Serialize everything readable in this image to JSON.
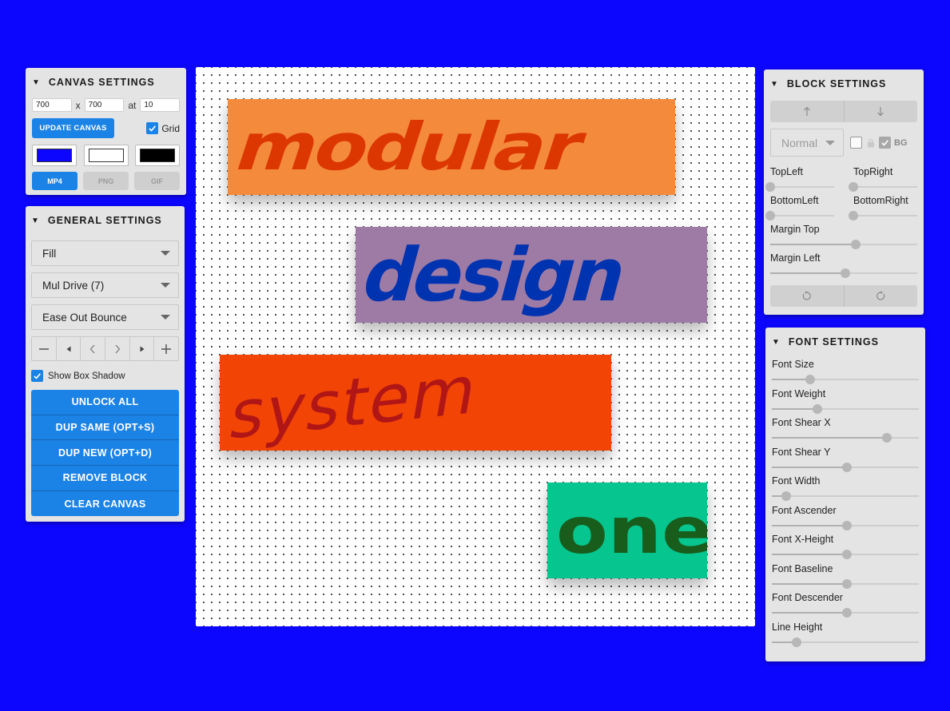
{
  "canvas_settings": {
    "title": "CANVAS SETTINGS",
    "width": "700",
    "x_label": "x",
    "height": "700",
    "at_label": "at",
    "grid_size": "10",
    "update_button": "UPDATE CANVAS",
    "grid_label": "Grid",
    "grid_checked": true,
    "swatches": [
      "#0d06ff",
      "#ffffff",
      "#000000"
    ],
    "export_buttons": [
      "MP4",
      "PNG",
      "GIF"
    ]
  },
  "general_settings": {
    "title": "GENERAL SETTINGS",
    "fill_mode": "Fill",
    "drive_mode": "Mul Drive (7)",
    "easing": "Ease Out Bounce",
    "show_box_shadow_label": "Show Box Shadow",
    "show_box_shadow_checked": true,
    "actions": [
      "UNLOCK ALL",
      "DUP SAME (OPT+S)",
      "DUP NEW (OPT+D)",
      "REMOVE BLOCK",
      "CLEAR CANVAS"
    ]
  },
  "canvas": {
    "background": "#ffffff",
    "blocks": [
      {
        "text": "modular",
        "bg": "#f48a3b",
        "color": "#dc3700"
      },
      {
        "text": "design",
        "bg": "#9e7ba5",
        "color": "#0033b0"
      },
      {
        "text": "system",
        "bg": "#f24405",
        "color": "#b01616"
      },
      {
        "text": "one",
        "bg": "#06c58e",
        "color": "#195d1c"
      }
    ]
  },
  "block_settings": {
    "title": "BLOCK SETTINGS",
    "blend_mode": "Normal",
    "bg_label": "BG",
    "top_left_label": "TopLeft",
    "top_right_label": "TopRight",
    "bottom_left_label": "BottomLeft",
    "bottom_right_label": "BottomRight",
    "margin_top_label": "Margin Top",
    "margin_left_label": "Margin Left",
    "top_left": 0,
    "top_right": 0,
    "bottom_left": 0,
    "bottom_right": 0,
    "margin_top": 0.58,
    "margin_left": 0.51
  },
  "font_settings": {
    "title": "FONT SETTINGS",
    "sliders": [
      {
        "label": "Font Size",
        "value": 0.26
      },
      {
        "label": "Font Weight",
        "value": 0.31
      },
      {
        "label": "Font Shear X",
        "value": 0.78
      },
      {
        "label": "Font Shear Y",
        "value": 0.51
      },
      {
        "label": "Font Width",
        "value": 0.1
      },
      {
        "label": "Font Ascender",
        "value": 0.51
      },
      {
        "label": "Font X-Height",
        "value": 0.51
      },
      {
        "label": "Font Baseline",
        "value": 0.51
      },
      {
        "label": "Font Descender",
        "value": 0.51
      },
      {
        "label": "Line Height",
        "value": 0.17
      }
    ]
  }
}
